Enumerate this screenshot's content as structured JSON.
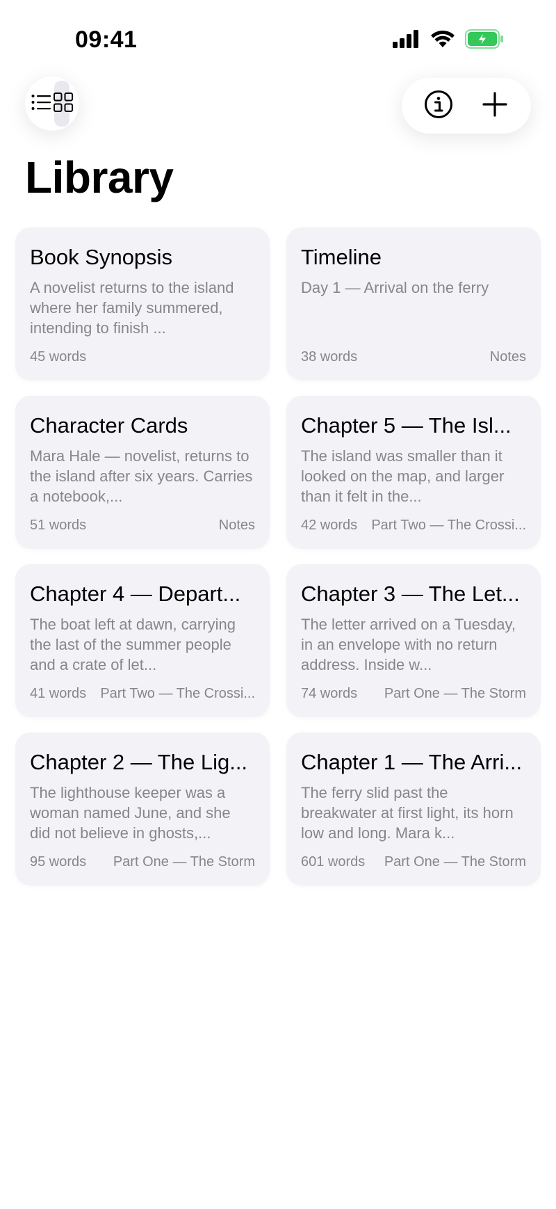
{
  "status_bar": {
    "time": "09:41",
    "icons": [
      "cellular-signal-icon",
      "wifi-icon",
      "battery-charging-icon"
    ],
    "battery_color": "#34c759"
  },
  "toolbar": {
    "view_toggle_icons": [
      "list-view-icon",
      "grid-view-icon"
    ],
    "actions": [
      "info-icon",
      "plus-icon"
    ]
  },
  "page": {
    "title": "Library"
  },
  "cards": [
    {
      "title": "Book Synopsis",
      "preview": "A novelist returns to the island where her family summered, intending to finish ...",
      "words": "45 words",
      "tag": ""
    },
    {
      "title": "Timeline",
      "preview": "Day 1 — Arrival on the ferry",
      "words": "38 words",
      "tag": "Notes"
    },
    {
      "title": "Character Cards",
      "preview": "Mara Hale — novelist, returns to the island after six years. Carries a notebook,...",
      "words": "51 words",
      "tag": "Notes"
    },
    {
      "title": "Chapter 5 — The Isl...",
      "preview": "The island was smaller than it looked on the map, and larger than it felt in the...",
      "words": "42 words",
      "tag": "Part Two — The Crossi..."
    },
    {
      "title": "Chapter 4 — Depart...",
      "preview": "The boat left at dawn, carrying the last of the summer people and a crate of let...",
      "words": "41 words",
      "tag": "Part Two — The Crossi..."
    },
    {
      "title": "Chapter 3 — The Let...",
      "preview": "The letter arrived on a Tuesday, in an envelope with no return address. Inside w...",
      "words": "74 words",
      "tag": "Part One — The Storm"
    },
    {
      "title": "Chapter 2 — The Lig...",
      "preview": "The lighthouse keeper was a woman named June, and she did not believe in ghosts,...",
      "words": "95 words",
      "tag": "Part One — The Storm"
    },
    {
      "title": "Chapter 1 — The Arri...",
      "preview": "The ferry slid past the breakwater at first light, its horn low and long. Mara k...",
      "words": "601 words",
      "tag": "Part One — The Storm"
    }
  ]
}
